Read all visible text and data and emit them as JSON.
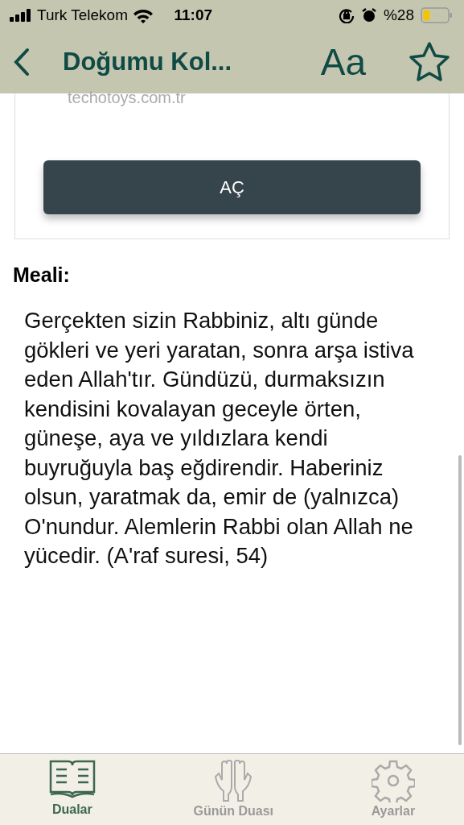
{
  "status_bar": {
    "carrier": "Turk Telekom",
    "time": "11:07",
    "battery": "%28"
  },
  "nav_bar": {
    "title": "Doğumu Kol...",
    "font_button": "Aa"
  },
  "card": {
    "link_text": "techotoys.com.tr",
    "button": "AÇ"
  },
  "meaning": {
    "heading": "Meali:",
    "text": "Gerçekten sizin Rabbiniz, altı günde gökleri ve yeri yaratan, sonra arşa istiva eden Allah'tır. Gündüzü, durmaksızın kendisini kovalayan geceyle örten, güneşe, aya ve yıldızlara kendi buyruğuyla baş eğdirendir. Haberiniz olsun, yaratmak da, emir de (yalnızca) O'nundur. Alemlerin Rabbi olan Allah ne yücedir. (A'raf suresi, 54)"
  },
  "tab_bar": [
    {
      "kind": "book",
      "label": "Dualar",
      "selected": true
    },
    {
      "kind": "hands",
      "label": "Günün Duası",
      "selected": false
    },
    {
      "kind": "gear",
      "label": "Ayarlar",
      "selected": false
    }
  ]
}
